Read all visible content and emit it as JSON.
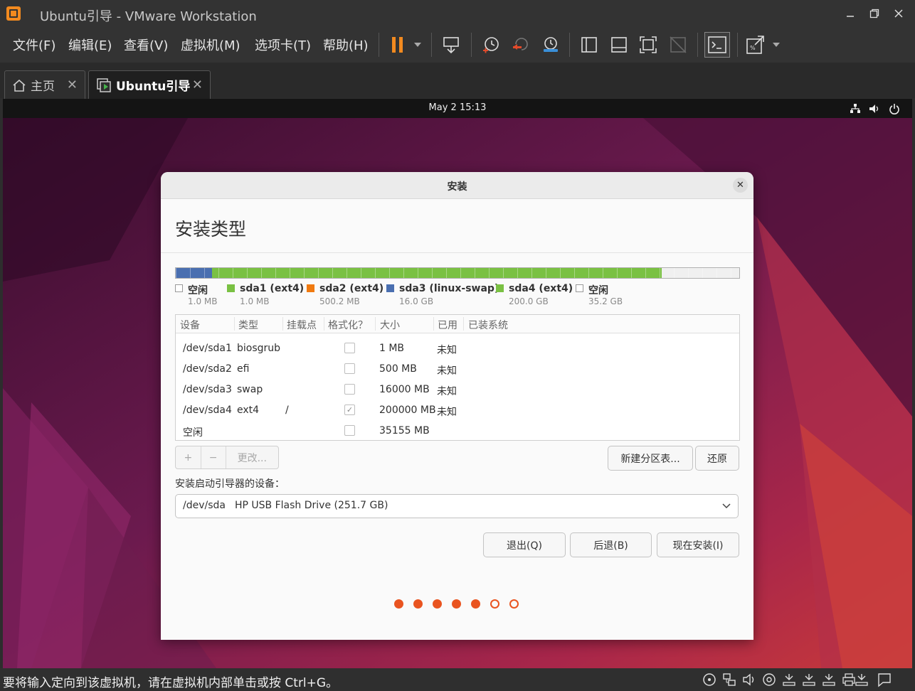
{
  "window": {
    "title": "Ubuntu引导 - VMware Workstation",
    "controls": [
      "minimize",
      "maximize",
      "close"
    ]
  },
  "menu": {
    "items": [
      "文件(F)",
      "编辑(E)",
      "查看(V)",
      "虚拟机(M)",
      "选项卡(T)",
      "帮助(H)"
    ]
  },
  "toolbar": {
    "icons": [
      "pause-icon",
      "send-ctrl-alt-del-icon",
      "snapshot-icon",
      "revert-snapshot-icon",
      "snapshot-manager-icon",
      "sidebar-icon",
      "thumbnail-icon",
      "fullscreen-icon",
      "unity-icon",
      "console-icon",
      "fit-window-icon"
    ],
    "accent_color": "#f28a1f"
  },
  "tabs": [
    {
      "label": "主页",
      "icon": "home-icon",
      "active": false
    },
    {
      "label": "Ubuntu引导",
      "icon": "vm-icon",
      "active": true
    }
  ],
  "guest": {
    "clock": "May 2  15:13",
    "tray_icons": [
      "network-icon",
      "volume-icon",
      "power-icon"
    ]
  },
  "installer": {
    "window_title": "安装",
    "heading": "安装类型",
    "partition_bar": [
      {
        "color": "#4a6fb0",
        "fraction": 0.0646
      },
      {
        "color": "#7ac143",
        "fraction": 0.7974
      },
      {
        "color": "#f0f0f0",
        "fraction": 0.138
      }
    ],
    "legend": [
      {
        "name": "空闲",
        "size": "1.0 MB",
        "color": "#ffffff"
      },
      {
        "name": "sda1 (ext4)",
        "size": "1.0 MB",
        "color": "#7ac143"
      },
      {
        "name": "sda2 (ext4)",
        "size": "500.2 MB",
        "color": "#f07a10"
      },
      {
        "name": "sda3 (linux-swap)",
        "size": "16.0 GB",
        "color": "#4a6fb0"
      },
      {
        "name": "sda4 (ext4)",
        "size": "200.0 GB",
        "color": "#7ac143"
      },
      {
        "name": "空闲",
        "size": "35.2 GB",
        "color": "#ffffff"
      }
    ],
    "table": {
      "columns": [
        "设备",
        "类型",
        "挂载点",
        "格式化？",
        "大小",
        "已用",
        "已装系统"
      ],
      "rows": [
        {
          "device": "/dev/sda1",
          "type": "biosgrub",
          "mount": "",
          "format": false,
          "size": "1 MB",
          "used": "未知"
        },
        {
          "device": "/dev/sda2",
          "type": "efi",
          "mount": "",
          "format": false,
          "size": "500 MB",
          "used": "未知"
        },
        {
          "device": "/dev/sda3",
          "type": "swap",
          "mount": "",
          "format": false,
          "size": "16000 MB",
          "used": "未知"
        },
        {
          "device": "/dev/sda4",
          "type": "ext4",
          "mount": "/",
          "format": true,
          "size": "200000 MB",
          "used": "未知"
        },
        {
          "device": "空闲",
          "type": "",
          "mount": "",
          "format": false,
          "size": "35155 MB",
          "used": ""
        }
      ]
    },
    "buttons": {
      "add": "+",
      "remove": "−",
      "change": "更改...",
      "new_table": "新建分区表...",
      "revert": "还原",
      "quit": "退出(Q)",
      "back": "后退(B)",
      "install": "现在安装(I)"
    },
    "boot_loader": {
      "label": "安装启动引导器的设备：",
      "device": "/dev/sda",
      "description": "HP USB Flash Drive (251.7 GB)"
    },
    "progress": {
      "total": 7,
      "completed": 5,
      "color": "#e95420"
    }
  },
  "statusbar": {
    "text": "要将输入定向到该虚拟机，请在虚拟机内部单击或按 Ctrl+G。",
    "icons": [
      "cd-icon",
      "network-adapter-icon",
      "sound-icon",
      "hdd-icon",
      "usb-icon",
      "usb-icon",
      "usb-icon",
      "printer-icon",
      "usb-icon",
      "message-icon"
    ]
  }
}
